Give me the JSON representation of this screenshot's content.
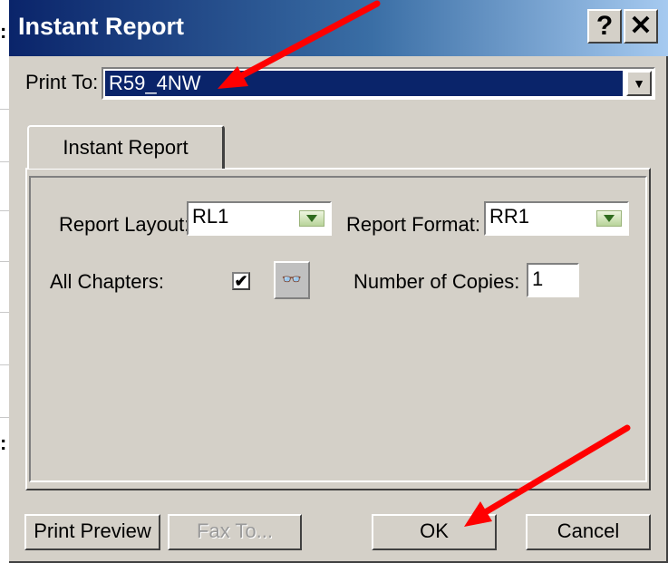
{
  "window": {
    "title": "Instant Report",
    "help_glyph": "?",
    "close_glyph": "✕"
  },
  "print_to": {
    "label": "Print To:",
    "value": "R59_4NW",
    "arrow_glyph": "▼"
  },
  "tabs": [
    {
      "label": "Instant Report",
      "selected": true
    }
  ],
  "form": {
    "report_layout": {
      "label": "Report Layout:",
      "value": "RL1"
    },
    "report_format": {
      "label": "Report Format:",
      "value": "RR1"
    },
    "all_chapters": {
      "label": "All Chapters:",
      "checked": true,
      "check_glyph": "✔"
    },
    "find_button": {
      "icon": "binoculars-icon",
      "glyph": "👓"
    },
    "copies": {
      "label": "Number of Copies:",
      "value": "1"
    }
  },
  "buttons": {
    "print_preview": "Print Preview",
    "fax_to": "Fax To...",
    "ok": "OK",
    "cancel": "Cancel"
  },
  "colors": {
    "title_bar_start": "#0a246a",
    "title_bar_end": "#a6caf0",
    "dialog_bg": "#d4d0c8",
    "selection": "#0a246a",
    "annotation_arrow": "#ff0000"
  }
}
